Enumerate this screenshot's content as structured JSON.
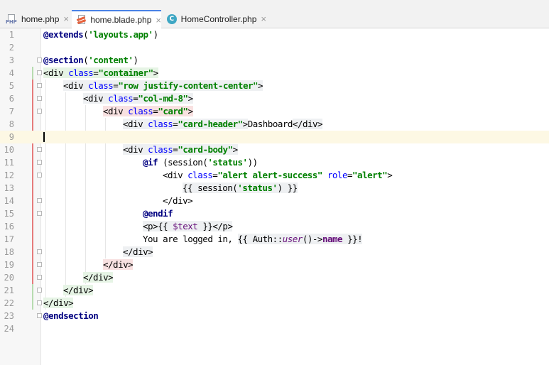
{
  "tabs": [
    {
      "label": "home.php",
      "icon": "php-file-icon",
      "active": false
    },
    {
      "label": "home.blade.php",
      "icon": "blade-file-icon",
      "active": true
    },
    {
      "label": "HomeController.php",
      "icon": "php-class-icon",
      "active": false
    }
  ],
  "tab_close_glyph": "×",
  "line_numbers": [
    "1",
    "2",
    "3",
    "4",
    "5",
    "6",
    "7",
    "8",
    "9",
    "10",
    "11",
    "12",
    "13",
    "14",
    "15",
    "16",
    "17",
    "18",
    "19",
    "20",
    "21",
    "22",
    "23",
    "24"
  ],
  "code": {
    "l1": {
      "d": "@extends",
      "p1": "(",
      "s": "'layouts.app'",
      "p2": ")"
    },
    "l3": {
      "d": "@section",
      "p1": "(",
      "s": "'content'",
      "p2": ")"
    },
    "l4": {
      "t1": "<div ",
      "a": "class",
      "eq": "=",
      "s": "\"container\"",
      "t2": ">"
    },
    "l5": {
      "t1": "<div ",
      "a": "class",
      "eq": "=",
      "s": "\"row justify-content-center\"",
      "t2": ">"
    },
    "l6": {
      "t1": "<div ",
      "a": "class",
      "eq": "=",
      "s": "\"col-md-8\"",
      "t2": ">"
    },
    "l7": {
      "t1": "<div ",
      "a": "class",
      "eq": "=",
      "s": "\"card\"",
      "t2": ">"
    },
    "l8": {
      "t1": "<div ",
      "a": "class",
      "eq": "=",
      "s": "\"card-header\"",
      "t2": ">",
      "txt": "Dashboard",
      "t3": "</div>"
    },
    "l10": {
      "t1": "<div ",
      "a": "class",
      "eq": "=",
      "s": "\"card-body\"",
      "t2": ">"
    },
    "l11": {
      "d": "@if",
      "p1": " (session(",
      "s": "'status'",
      "p2": "))"
    },
    "l12": {
      "t1": "<div ",
      "a": "class",
      "eq": "=",
      "s": "\"alert alert-success\"",
      "sp": " ",
      "a2": "role",
      "eq2": "=",
      "s2": "\"alert\"",
      "t2": ">"
    },
    "l13": {
      "p1": "{{ session(",
      "s": "'status'",
      "p2": ") }}"
    },
    "l14": {
      "t": "</div>"
    },
    "l15": {
      "d": "@endif"
    },
    "l16": {
      "t1": "<p>",
      "p1": "{{ ",
      "v": "$text",
      "p2": " }}",
      "t2": "</p>"
    },
    "l17": {
      "txt": "You are logged in, ",
      "p1": "{{ Auth::",
      "m": "user",
      "p2": "()->",
      "pr": "name",
      "p3": " }}!"
    },
    "l18": {
      "t": "</div>"
    },
    "l19": {
      "t": "</div>"
    },
    "l20": {
      "t": "</div>"
    },
    "l21": {
      "t": "</div>"
    },
    "l22": {
      "t": "</div>"
    },
    "l23": {
      "d": "@endsection"
    }
  },
  "colors": {
    "active_tab_border": "#4a82e6",
    "current_line": "#fdf8e4",
    "added_marker": "#b7dcb0",
    "modified_marker": "#e67b7b"
  }
}
